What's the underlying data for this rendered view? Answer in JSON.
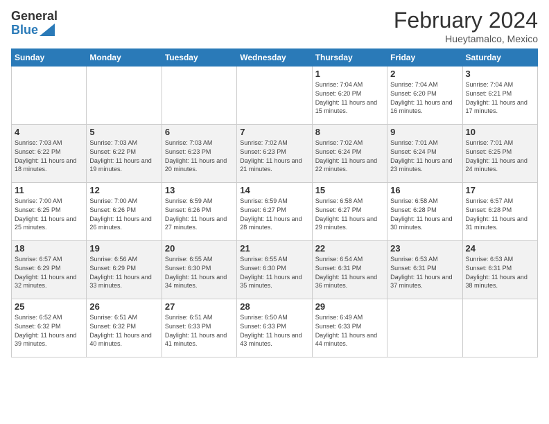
{
  "logo": {
    "general": "General",
    "blue": "Blue"
  },
  "header": {
    "title": "February 2024",
    "subtitle": "Hueytamalco, Mexico"
  },
  "weekdays": [
    "Sunday",
    "Monday",
    "Tuesday",
    "Wednesday",
    "Thursday",
    "Friday",
    "Saturday"
  ],
  "weeks": [
    [
      {
        "day": "",
        "info": ""
      },
      {
        "day": "",
        "info": ""
      },
      {
        "day": "",
        "info": ""
      },
      {
        "day": "",
        "info": ""
      },
      {
        "day": "1",
        "info": "Sunrise: 7:04 AM\nSunset: 6:20 PM\nDaylight: 11 hours and 15 minutes."
      },
      {
        "day": "2",
        "info": "Sunrise: 7:04 AM\nSunset: 6:20 PM\nDaylight: 11 hours and 16 minutes."
      },
      {
        "day": "3",
        "info": "Sunrise: 7:04 AM\nSunset: 6:21 PM\nDaylight: 11 hours and 17 minutes."
      }
    ],
    [
      {
        "day": "4",
        "info": "Sunrise: 7:03 AM\nSunset: 6:22 PM\nDaylight: 11 hours and 18 minutes."
      },
      {
        "day": "5",
        "info": "Sunrise: 7:03 AM\nSunset: 6:22 PM\nDaylight: 11 hours and 19 minutes."
      },
      {
        "day": "6",
        "info": "Sunrise: 7:03 AM\nSunset: 6:23 PM\nDaylight: 11 hours and 20 minutes."
      },
      {
        "day": "7",
        "info": "Sunrise: 7:02 AM\nSunset: 6:23 PM\nDaylight: 11 hours and 21 minutes."
      },
      {
        "day": "8",
        "info": "Sunrise: 7:02 AM\nSunset: 6:24 PM\nDaylight: 11 hours and 22 minutes."
      },
      {
        "day": "9",
        "info": "Sunrise: 7:01 AM\nSunset: 6:24 PM\nDaylight: 11 hours and 23 minutes."
      },
      {
        "day": "10",
        "info": "Sunrise: 7:01 AM\nSunset: 6:25 PM\nDaylight: 11 hours and 24 minutes."
      }
    ],
    [
      {
        "day": "11",
        "info": "Sunrise: 7:00 AM\nSunset: 6:25 PM\nDaylight: 11 hours and 25 minutes."
      },
      {
        "day": "12",
        "info": "Sunrise: 7:00 AM\nSunset: 6:26 PM\nDaylight: 11 hours and 26 minutes."
      },
      {
        "day": "13",
        "info": "Sunrise: 6:59 AM\nSunset: 6:26 PM\nDaylight: 11 hours and 27 minutes."
      },
      {
        "day": "14",
        "info": "Sunrise: 6:59 AM\nSunset: 6:27 PM\nDaylight: 11 hours and 28 minutes."
      },
      {
        "day": "15",
        "info": "Sunrise: 6:58 AM\nSunset: 6:27 PM\nDaylight: 11 hours and 29 minutes."
      },
      {
        "day": "16",
        "info": "Sunrise: 6:58 AM\nSunset: 6:28 PM\nDaylight: 11 hours and 30 minutes."
      },
      {
        "day": "17",
        "info": "Sunrise: 6:57 AM\nSunset: 6:28 PM\nDaylight: 11 hours and 31 minutes."
      }
    ],
    [
      {
        "day": "18",
        "info": "Sunrise: 6:57 AM\nSunset: 6:29 PM\nDaylight: 11 hours and 32 minutes."
      },
      {
        "day": "19",
        "info": "Sunrise: 6:56 AM\nSunset: 6:29 PM\nDaylight: 11 hours and 33 minutes."
      },
      {
        "day": "20",
        "info": "Sunrise: 6:55 AM\nSunset: 6:30 PM\nDaylight: 11 hours and 34 minutes."
      },
      {
        "day": "21",
        "info": "Sunrise: 6:55 AM\nSunset: 6:30 PM\nDaylight: 11 hours and 35 minutes."
      },
      {
        "day": "22",
        "info": "Sunrise: 6:54 AM\nSunset: 6:31 PM\nDaylight: 11 hours and 36 minutes."
      },
      {
        "day": "23",
        "info": "Sunrise: 6:53 AM\nSunset: 6:31 PM\nDaylight: 11 hours and 37 minutes."
      },
      {
        "day": "24",
        "info": "Sunrise: 6:53 AM\nSunset: 6:31 PM\nDaylight: 11 hours and 38 minutes."
      }
    ],
    [
      {
        "day": "25",
        "info": "Sunrise: 6:52 AM\nSunset: 6:32 PM\nDaylight: 11 hours and 39 minutes."
      },
      {
        "day": "26",
        "info": "Sunrise: 6:51 AM\nSunset: 6:32 PM\nDaylight: 11 hours and 40 minutes."
      },
      {
        "day": "27",
        "info": "Sunrise: 6:51 AM\nSunset: 6:33 PM\nDaylight: 11 hours and 41 minutes."
      },
      {
        "day": "28",
        "info": "Sunrise: 6:50 AM\nSunset: 6:33 PM\nDaylight: 11 hours and 43 minutes."
      },
      {
        "day": "29",
        "info": "Sunrise: 6:49 AM\nSunset: 6:33 PM\nDaylight: 11 hours and 44 minutes."
      },
      {
        "day": "",
        "info": ""
      },
      {
        "day": "",
        "info": ""
      }
    ]
  ]
}
